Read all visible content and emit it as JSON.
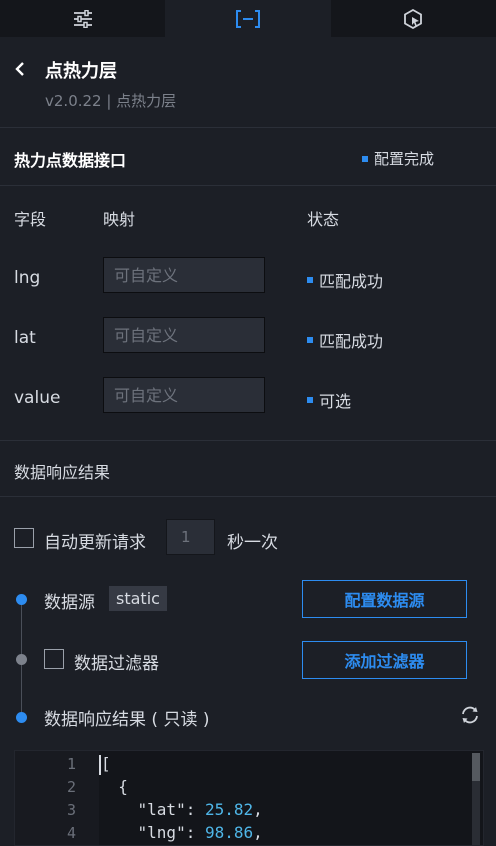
{
  "tabs": [
    {
      "name": "sliders-icon",
      "active": false
    },
    {
      "name": "data-bracket-icon",
      "active": true
    },
    {
      "name": "interaction-icon",
      "active": false
    }
  ],
  "header": {
    "title": "点热力层",
    "subtitle": "v2.0.22 | 点热力层"
  },
  "api_section": {
    "title": "热力点数据接口",
    "status": "配置完成"
  },
  "table": {
    "headers": {
      "field": "字段",
      "mapping": "映射",
      "status": "状态"
    },
    "rows": [
      {
        "field": "lng",
        "placeholder": "可自定义",
        "status": "匹配成功"
      },
      {
        "field": "lat",
        "placeholder": "可自定义",
        "status": "匹配成功"
      },
      {
        "field": "value",
        "placeholder": "可自定义",
        "status": "可选"
      }
    ]
  },
  "response": {
    "title": "数据响应结果",
    "auto_update_label": "自动更新请求",
    "interval_value": "1",
    "interval_unit": "秒一次",
    "datasource_label": "数据源",
    "datasource_tag": "static",
    "config_button": "配置数据源",
    "filter_label": "数据过滤器",
    "filter_button": "添加过滤器",
    "result_label": "数据响应结果 ( 只读 )"
  },
  "editor": {
    "line_numbers": [
      "1",
      "2",
      "3",
      "4"
    ],
    "lines": [
      {
        "pre": "[",
        "key": "",
        "num": "",
        "post": ""
      },
      {
        "pre": "  {",
        "key": "",
        "num": "",
        "post": ""
      },
      {
        "pre": "    ",
        "key": "\"lat\": ",
        "num": "25.82",
        "post": ","
      },
      {
        "pre": "    ",
        "key": "\"lng\": ",
        "num": "98.86",
        "post": ","
      }
    ]
  },
  "colors": {
    "accent": "#2d8cf0",
    "background": "#1c1f26",
    "number": "#4fb6e8"
  }
}
